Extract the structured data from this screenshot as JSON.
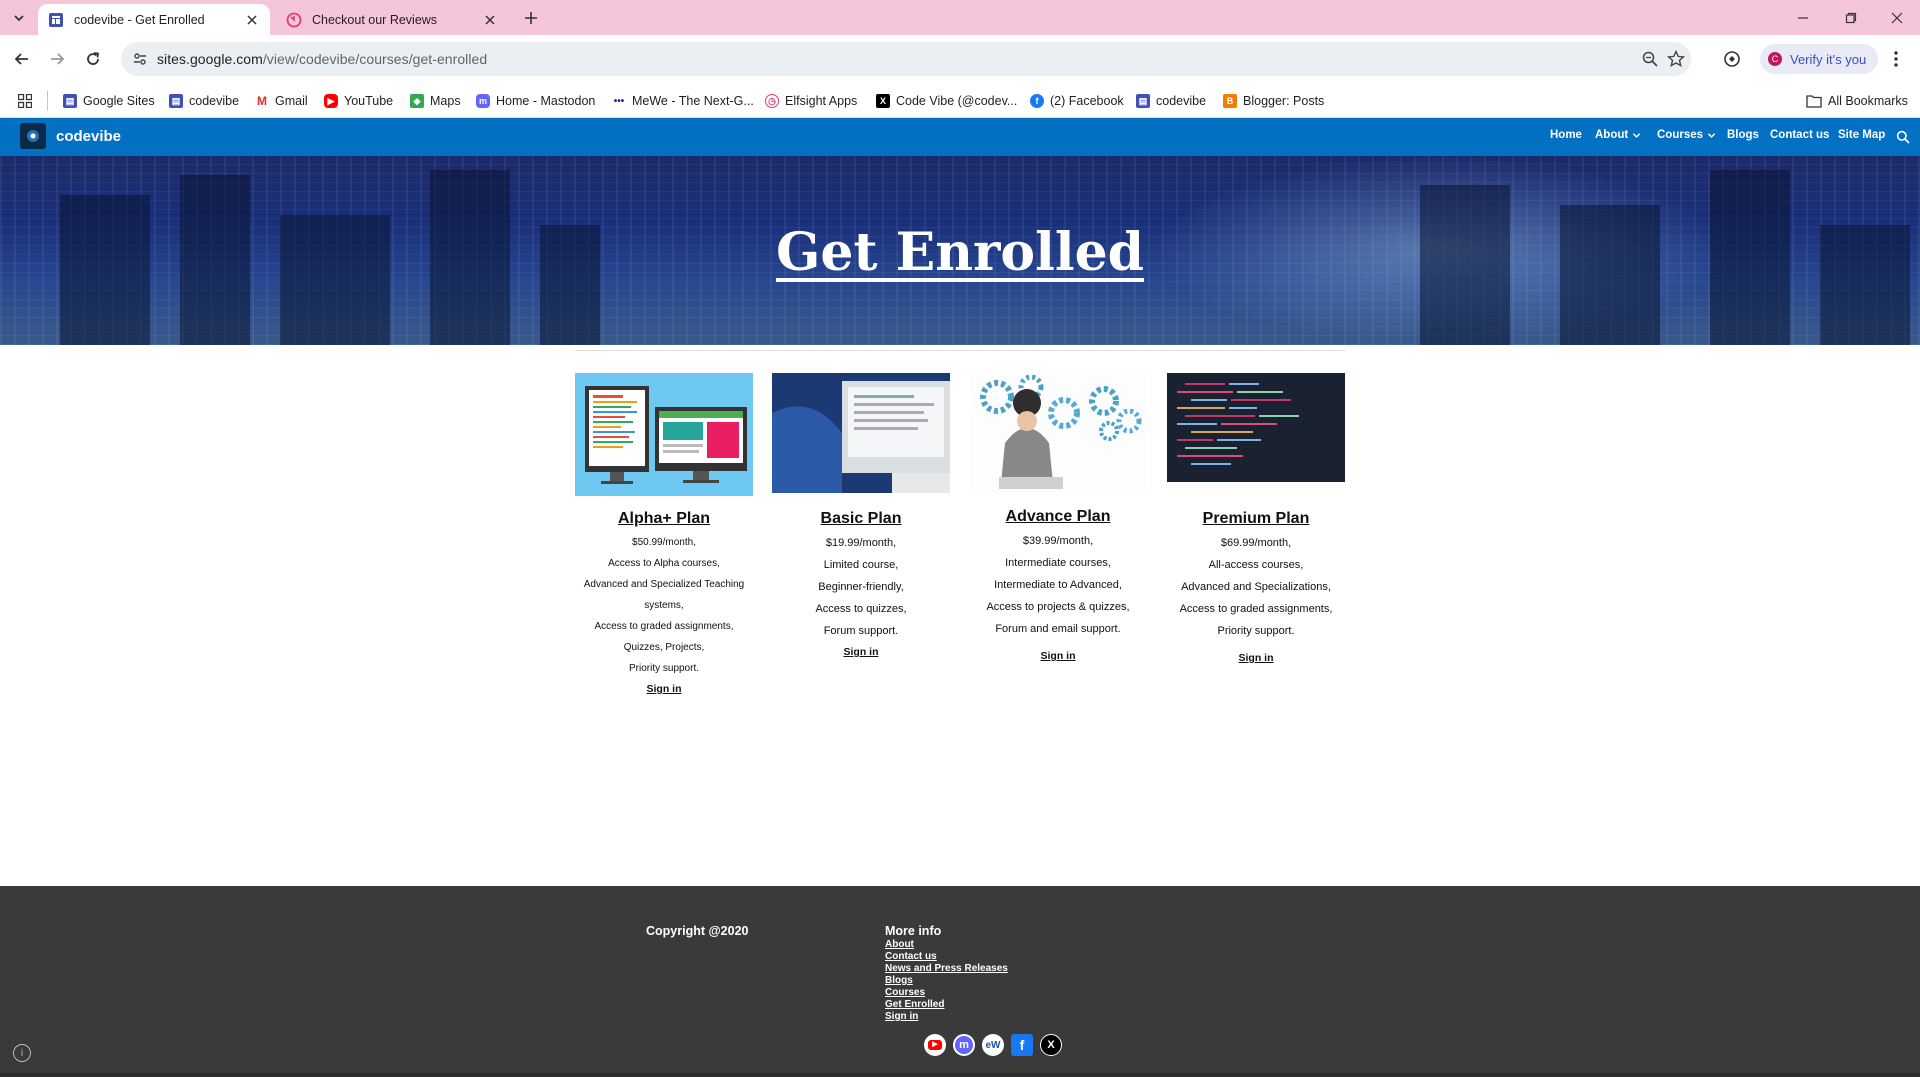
{
  "browser": {
    "tabs": [
      {
        "title": "codevibe - Get Enrolled",
        "active": true
      },
      {
        "title": "Checkout our Reviews",
        "active": false
      }
    ],
    "url_host": "sites.google.com",
    "url_path": "/view/codevibe/courses/get-enrolled",
    "verify_label": "Verify it's you",
    "bookmarks": [
      {
        "label": "Google Sites",
        "icon": "google-sites-icon"
      },
      {
        "label": "codevibe",
        "icon": "google-sites-icon"
      },
      {
        "label": "Gmail",
        "icon": "gmail-icon"
      },
      {
        "label": "YouTube",
        "icon": "youtube-icon"
      },
      {
        "label": "Maps",
        "icon": "maps-icon"
      },
      {
        "label": "Home - Mastodon",
        "icon": "mastodon-icon"
      },
      {
        "label": "MeWe - The Next-G...",
        "icon": "mewe-icon"
      },
      {
        "label": "Elfsight Apps",
        "icon": "elfsight-icon"
      },
      {
        "label": "Code Vibe (@codev...",
        "icon": "x-icon"
      },
      {
        "label": "(2) Facebook",
        "icon": "facebook-icon"
      },
      {
        "label": "codevibe",
        "icon": "google-sites-icon"
      },
      {
        "label": "Blogger: Posts",
        "icon": "blogger-icon"
      }
    ],
    "all_bookmarks": "All Bookmarks"
  },
  "site": {
    "title": "codevibe",
    "nav": [
      "Home",
      "About",
      "Courses",
      "Blogs",
      "Contact us",
      "Site Map"
    ]
  },
  "hero": {
    "title": "Get Enrolled"
  },
  "plans": [
    {
      "name": "Alpha+ Plan",
      "lines": [
        "$50.99/month,",
        "Access to Alpha courses,",
        "Advanced and Specialized Teaching",
        "systems,",
        "Access to graded assignments,",
        "Quizzes, Projects,",
        "Priority support."
      ],
      "signin": "Sign in"
    },
    {
      "name": "Basic Plan",
      "lines": [
        "$19.99/month,",
        "Limited course,",
        "Beginner-friendly,",
        "Access to quizzes,",
        "Forum support."
      ],
      "signin": "Sign in"
    },
    {
      "name": "Advance Plan",
      "lines": [
        "$39.99/month,",
        "Intermediate courses,",
        "Intermediate to Advanced,",
        "Access to projects & quizzes,",
        "Forum and email support."
      ],
      "signin": "Sign in"
    },
    {
      "name": "Premium Plan",
      "lines": [
        "$69.99/month,",
        "All-access courses,",
        "Advanced and Specializations,",
        "Access to graded assignments,",
        "Priority support."
      ],
      "signin": "Sign in"
    }
  ],
  "footer": {
    "copyright": "Copyright @2020",
    "more_info": "More info",
    "links": [
      "About",
      "Contact us",
      "News and Press Releases",
      "Blogs",
      "Courses",
      "Get Enrolled",
      "Sign in"
    ],
    "socials": [
      "youtube-icon",
      "mastodon-icon",
      "mewe-icon",
      "facebook-icon",
      "x-icon"
    ]
  },
  "colors": {
    "tab_strip": "#f5c6d9",
    "site_header": "#0271c4",
    "footer": "#3a3a3a"
  }
}
